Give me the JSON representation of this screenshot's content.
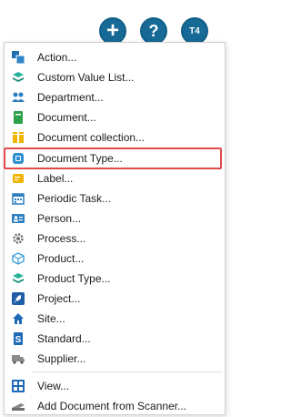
{
  "topbar": {
    "add_symbol": "+",
    "help_symbol": "?",
    "avatar_initials": "T4"
  },
  "menu": {
    "items": [
      {
        "label": "Action...",
        "icon": "action-icon"
      },
      {
        "label": "Custom Value List...",
        "icon": "stack-layers-icon"
      },
      {
        "label": "Department...",
        "icon": "people-group-icon"
      },
      {
        "label": "Document...",
        "icon": "document-icon"
      },
      {
        "label": "Document collection...",
        "icon": "folder-collection-icon"
      },
      {
        "label": "Document Type...",
        "icon": "document-type-icon",
        "highlighted": true
      },
      {
        "label": "Label...",
        "icon": "label-tag-icon"
      },
      {
        "label": "Periodic Task...",
        "icon": "calendar-icon"
      },
      {
        "label": "Person...",
        "icon": "id-card-icon"
      },
      {
        "label": "Process...",
        "icon": "gear-icon"
      },
      {
        "label": "Product...",
        "icon": "cube-icon"
      },
      {
        "label": "Product Type...",
        "icon": "layers-icon"
      },
      {
        "label": "Project...",
        "icon": "rocket-icon"
      },
      {
        "label": "Site...",
        "icon": "home-icon"
      },
      {
        "label": "Standard...",
        "icon": "standard-book-icon"
      },
      {
        "label": "Supplier...",
        "icon": "truck-icon"
      },
      {
        "label": "View...",
        "icon": "grid-view-icon"
      },
      {
        "label": "Add Document from Scanner...",
        "icon": "scanner-icon"
      }
    ]
  },
  "colors": {
    "accent": "#176a96",
    "highlight_border": "#e24a4a"
  }
}
